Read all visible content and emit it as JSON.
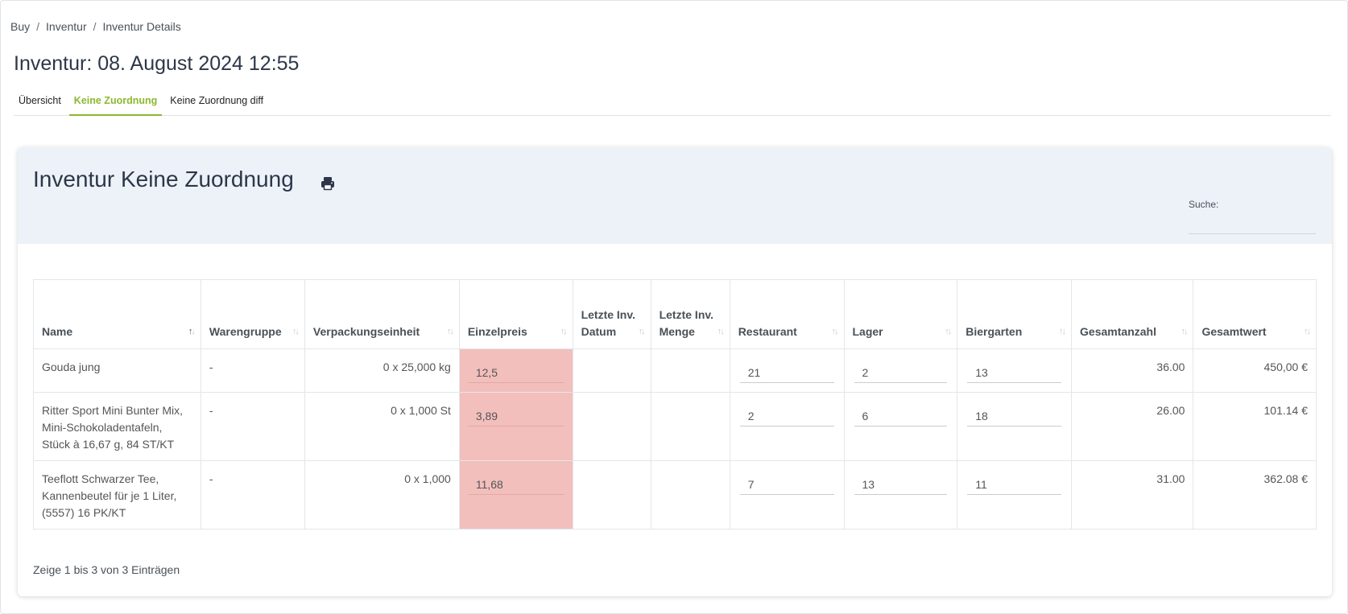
{
  "breadcrumb": {
    "items": [
      "Buy",
      "Inventur",
      "Inventur Details"
    ],
    "separator": "/"
  },
  "page": {
    "title": "Inventur: 08. August 2024 12:55"
  },
  "tabs": [
    {
      "label": "Übersicht",
      "active": false
    },
    {
      "label": "Keine Zuordnung",
      "active": true
    },
    {
      "label": "Keine Zuordnung diff",
      "active": false
    }
  ],
  "card": {
    "title": "Inventur Keine Zuordnung",
    "print_icon": "print-icon",
    "search_label": "Suche:",
    "search_value": ""
  },
  "table": {
    "columns": [
      "Name",
      "Warengruppe",
      "Verpackungseinheit",
      "Einzelpreis",
      "Letzte Inv. Datum",
      "Letzte Inv. Menge",
      "Restaurant",
      "Lager",
      "Biergarten",
      "Gesamtanzahl",
      "Gesamtwert"
    ],
    "rows": [
      {
        "name": "Gouda jung",
        "warengruppe": "-",
        "verpackungseinheit": "0 x 25,000 kg",
        "einzelpreis": "12,5",
        "letzte_inv_datum": "",
        "letzte_inv_menge": "",
        "restaurant": "21",
        "lager": "2",
        "biergarten": "13",
        "gesamtanzahl": "36.00",
        "gesamtwert": "450,00 €"
      },
      {
        "name": "Ritter Sport Mini Bunter Mix, Mini-Schokoladentafeln, Stück à 16,67 g, 84 ST/KT",
        "warengruppe": "-",
        "verpackungseinheit": "0 x 1,000 St",
        "einzelpreis": "3,89",
        "letzte_inv_datum": "",
        "letzte_inv_menge": "",
        "restaurant": "2",
        "lager": "6",
        "biergarten": "18",
        "gesamtanzahl": "26.00",
        "gesamtwert": "101.14 €"
      },
      {
        "name": "Teeflott Schwarzer Tee, Kannenbeutel für je 1 Liter, (5557) 16 PK/KT",
        "warengruppe": "-",
        "verpackungseinheit": "0 x 1,000",
        "einzelpreis": "11,68",
        "letzte_inv_datum": "",
        "letzte_inv_menge": "",
        "restaurant": "7",
        "lager": "13",
        "biergarten": "11",
        "gesamtanzahl": "31.00",
        "gesamtwert": "362.08 €"
      }
    ],
    "footer": "Zeige 1 bis 3 von 3 Einträgen"
  },
  "colors": {
    "accent": "#8cb82f",
    "header_bg": "#edf2f9",
    "price_highlight": "#f2bfbc"
  }
}
